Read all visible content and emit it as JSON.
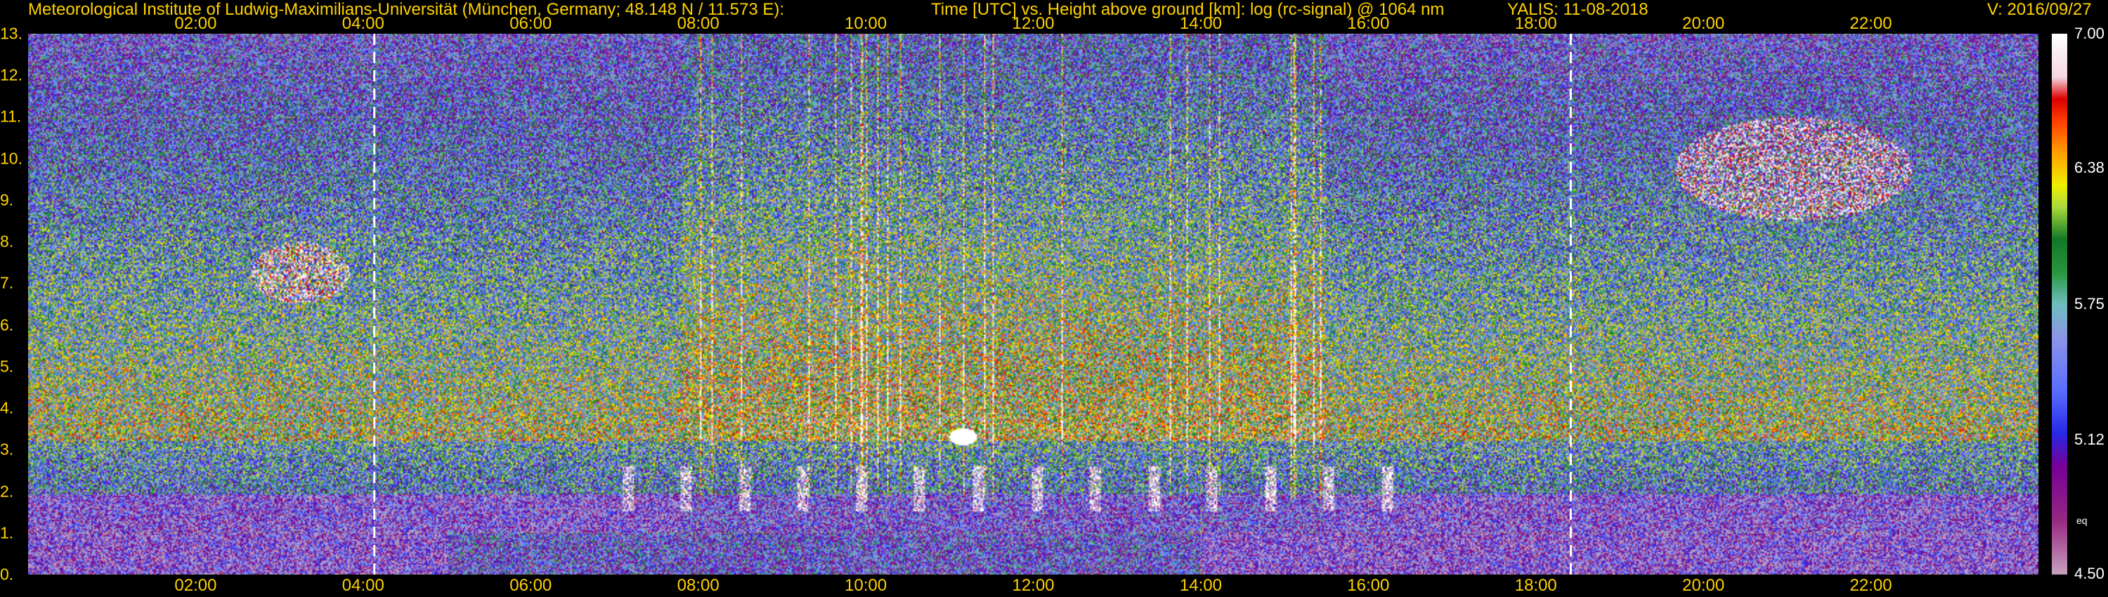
{
  "header": {
    "institute": "Meteorological Institute of Ludwig-Maximilians-Universität (München, Germany; 48.148 N / 11.573 E):",
    "axes_desc": "Time [UTC] vs. Height above ground [km]: log (rc-signal) @ 1064 nm",
    "instrument_date": "YALIS: 11-08-2018",
    "version": "V: 2016/09/27"
  },
  "chart_data": {
    "type": "heatmap",
    "x_label": "Time [UTC]",
    "y_label": "Height above ground [km]",
    "quantity": "log (rc-signal) @ 1064 nm",
    "xlim": [
      "00:00",
      "24:00"
    ],
    "x_ticks": [
      "02:00",
      "04:00",
      "06:00",
      "08:00",
      "10:00",
      "12:00",
      "14:00",
      "16:00",
      "18:00",
      "20:00",
      "22:00"
    ],
    "ylim": [
      0,
      13
    ],
    "y_ticks": [
      "0.",
      "1.",
      "2.",
      "3.",
      "4.",
      "5.",
      "6.",
      "7.",
      "8.",
      "9.",
      "10.",
      "11.",
      "12.",
      "13."
    ],
    "grid": true,
    "dashed_markers_utc": [
      "04:08",
      "18:25"
    ],
    "colorbar": {
      "range": [
        4.5,
        7.0
      ],
      "ticks": [
        "7.00",
        "6.38",
        "5.75",
        "5.12",
        "4.50"
      ],
      "label": "eq"
    },
    "features": [
      {
        "kind": "cirrus",
        "time": [
          "02:40",
          "03:50"
        ],
        "height_km": [
          6.5,
          8.0
        ]
      },
      {
        "kind": "boundary_layer_clouds",
        "time": [
          "06:40",
          "16:20"
        ],
        "height_km": [
          1.5,
          2.6
        ]
      },
      {
        "kind": "cloud",
        "time": [
          "11:00",
          "11:20"
        ],
        "height_km": [
          3.1,
          3.5
        ]
      },
      {
        "kind": "cirrus",
        "time": [
          "19:40",
          "22:30"
        ],
        "height_km": [
          8.5,
          11.0
        ]
      }
    ]
  }
}
